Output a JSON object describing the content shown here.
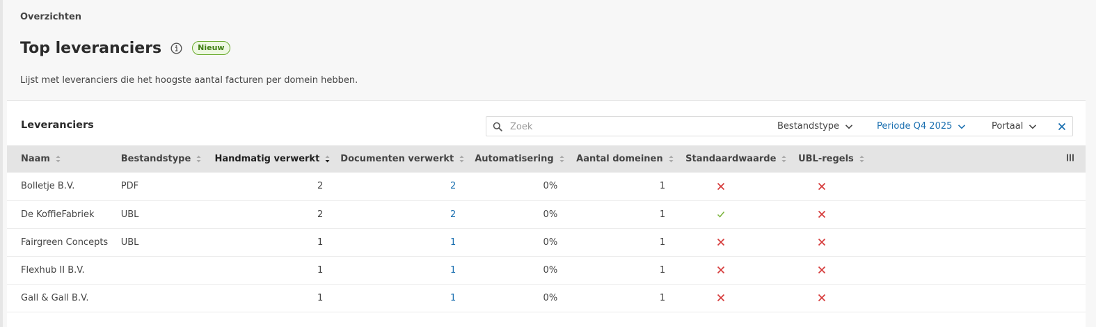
{
  "breadcrumb": "Overzichten",
  "page": {
    "title": "Top leveranciers",
    "badge": "Nieuw",
    "description": "Lijst met leveranciers die het hoogste aantal facturen per domein hebben."
  },
  "card": {
    "title": "Leveranciers",
    "search": {
      "placeholder": "Zoek",
      "value": ""
    },
    "filters": {
      "file_type": "Bestandstype",
      "period": "Periode Q4 2025",
      "portal": "Portaal"
    }
  },
  "table": {
    "columns": {
      "name": "Naam",
      "file_type": "Bestandstype",
      "manual": "Handmatig verwerkt",
      "documents": "Documenten verwerkt",
      "automation": "Automatisering",
      "domains": "Aantal domeinen",
      "default_value": "Standaardwaarde",
      "ubl_rules": "UBL-regels"
    },
    "sorted_column": "manual",
    "sort_direction": "desc",
    "rows": [
      {
        "name": "Bolletje B.V.",
        "file_type": "PDF",
        "manual": "2",
        "documents": "2",
        "automation": "0%",
        "domains": "1",
        "default_value": false,
        "ubl_rules": false
      },
      {
        "name": "De KoffieFabriek",
        "file_type": "UBL",
        "manual": "2",
        "documents": "2",
        "automation": "0%",
        "domains": "1",
        "default_value": true,
        "ubl_rules": false
      },
      {
        "name": "Fairgreen Concepts",
        "file_type": "UBL",
        "manual": "1",
        "documents": "1",
        "automation": "0%",
        "domains": "1",
        "default_value": false,
        "ubl_rules": false
      },
      {
        "name": "Flexhub II B.V.",
        "file_type": "",
        "manual": "1",
        "documents": "1",
        "automation": "0%",
        "domains": "1",
        "default_value": false,
        "ubl_rules": false
      },
      {
        "name": "Gall & Gall B.V.",
        "file_type": "",
        "manual": "1",
        "documents": "1",
        "automation": "0%",
        "domains": "1",
        "default_value": false,
        "ubl_rules": false
      }
    ]
  },
  "icons": {
    "info": "info-circle-icon",
    "search": "search-icon",
    "chevron": "chevron-down-icon",
    "clear": "close-icon",
    "columns": "columns-icon",
    "true_mark": "check-icon",
    "false_mark": "cross-icon"
  },
  "colors": {
    "accent": "#1a6fb0",
    "badge_green": "#6aab2e",
    "check_green": "#7ab33a",
    "cross_red": "#d63b3b"
  }
}
